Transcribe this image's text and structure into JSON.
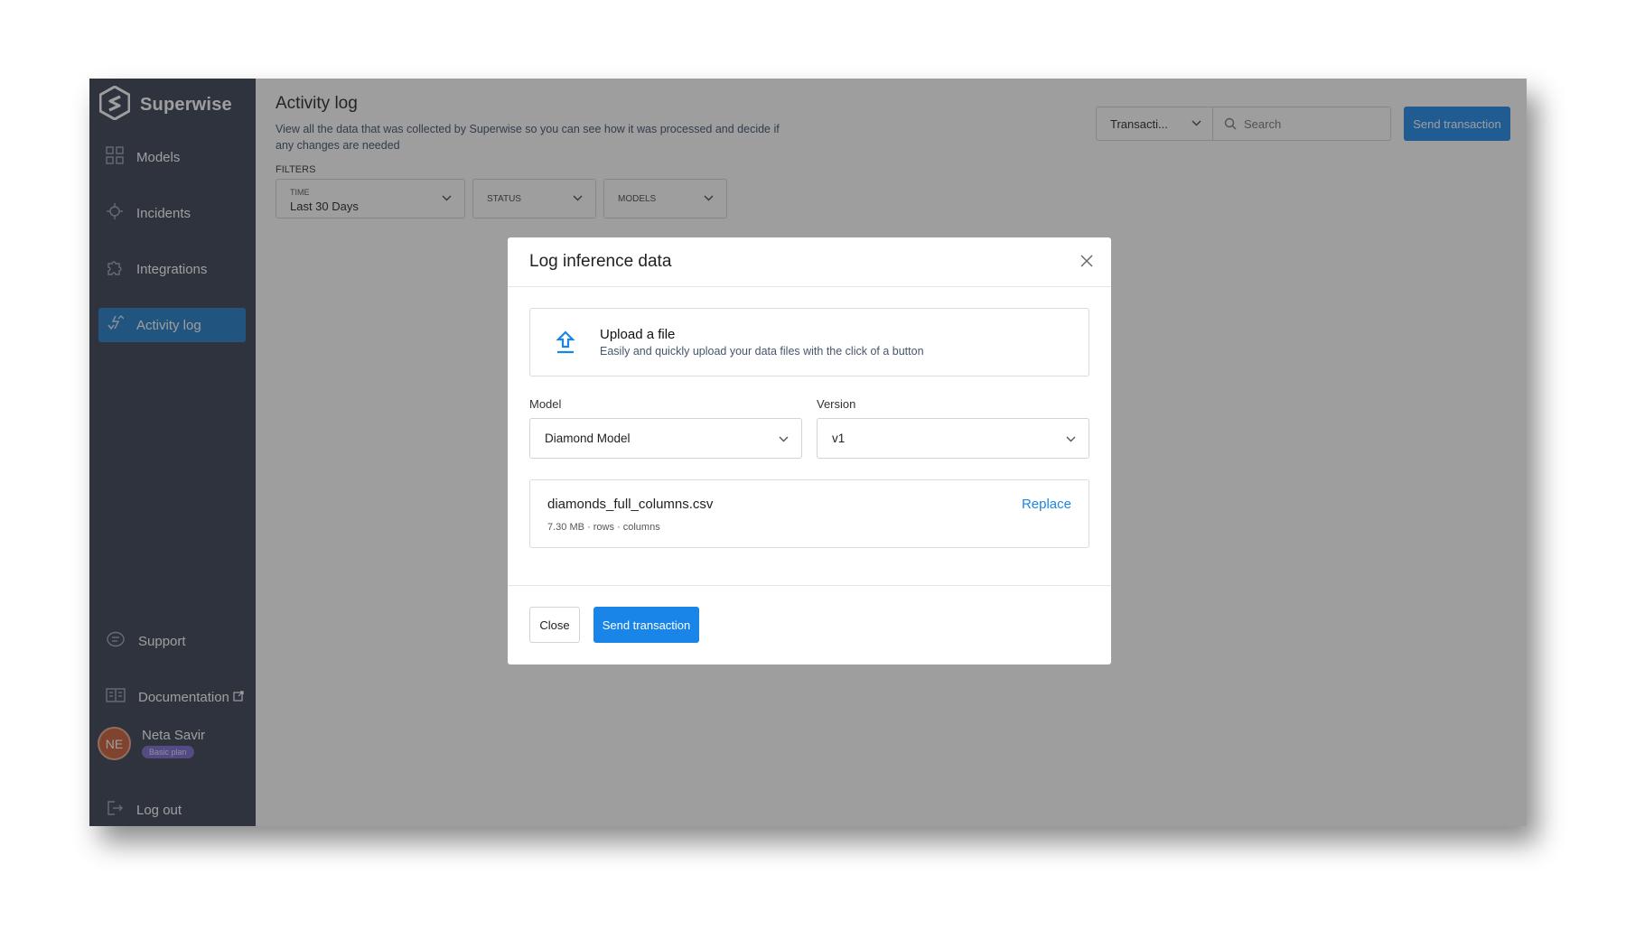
{
  "sidebar": {
    "brand": "Superwise",
    "nav": [
      {
        "label": "Models",
        "icon": "grid-icon"
      },
      {
        "label": "Incidents",
        "icon": "crosshair-icon"
      },
      {
        "label": "Integrations",
        "icon": "puzzle-icon"
      },
      {
        "label": "Activity log",
        "icon": "activity-arrows-icon",
        "active": true
      }
    ],
    "bottom": [
      {
        "label": "Support",
        "icon": "chat-icon"
      },
      {
        "label": "Documentation",
        "icon": "book-icon"
      }
    ],
    "user": {
      "initials": "NE",
      "name": "Neta Savir",
      "plan": "Basic plan"
    },
    "logout": "Log out"
  },
  "page": {
    "title": "Activity log",
    "description": "View all the data that was collected by Superwise so you can see how it was processed and decide if any changes are needed",
    "filters_label": "FILTERS",
    "filters": [
      {
        "caption": "TIME",
        "value": "Last 30 Days"
      },
      {
        "caption": "STATUS"
      },
      {
        "caption": "MODELS"
      }
    ],
    "type_select": "Transacti...",
    "search_placeholder": "Search",
    "send_button": "Send transaction"
  },
  "modal": {
    "title": "Log inference data",
    "upload": {
      "title": "Upload a file",
      "subtitle": "Easily and quickly upload your data files with the click of a button"
    },
    "model_label": "Model",
    "model_value": "Diamond Model",
    "version_label": "Version",
    "version_value": "v1",
    "file": {
      "name": "diamonds_full_columns.csv",
      "meta": "7.30 MB · rows · columns",
      "replace": "Replace"
    },
    "close_button": "Close",
    "send_button": "Send transaction"
  },
  "colors": {
    "sidebar": "#353c50",
    "accent": "#1a85e8",
    "active_nav": "#1e78c8"
  }
}
